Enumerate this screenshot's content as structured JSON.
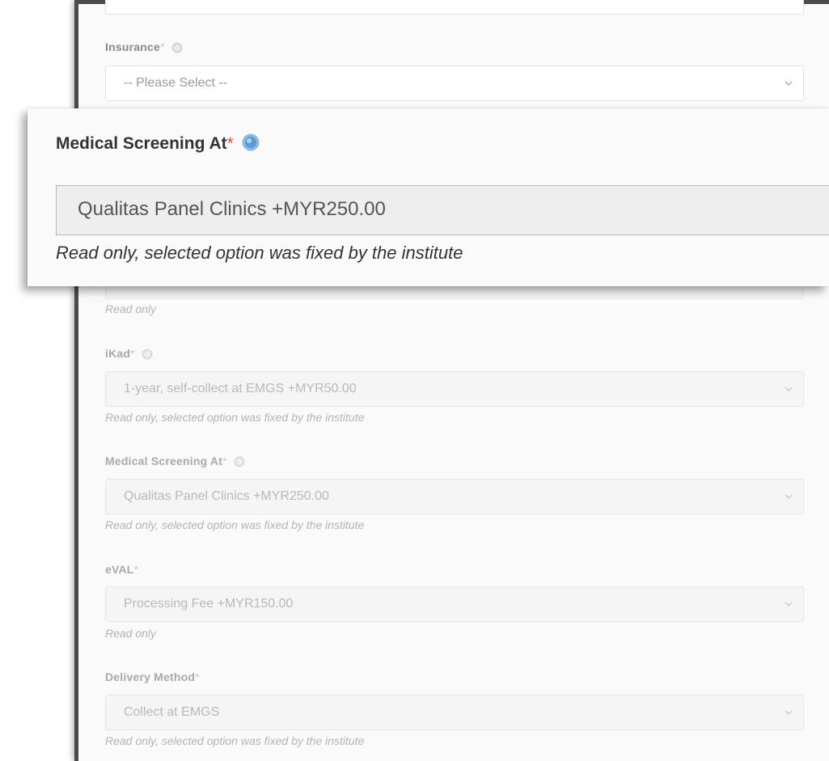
{
  "fields": {
    "top_partial": {
      "value": ""
    },
    "insurance": {
      "label": "Insurance",
      "required_mark": "*",
      "value": "-- Please Select --"
    },
    "hidden_field": {
      "help_text": "Read only"
    },
    "ikad": {
      "label": "iKad",
      "required_mark": "*",
      "value": "1-year, self-collect at EMGS +MYR50.00",
      "help_text": "Read only, selected option was fixed by the institute"
    },
    "medical_screening": {
      "label": "Medical Screening At",
      "required_mark": "*",
      "value": "Qualitas Panel Clinics +MYR250.00",
      "help_text": "Read only, selected option was fixed by the institute"
    },
    "eval": {
      "label": "eVAL",
      "required_mark": "*",
      "value": "Processing Fee +MYR150.00",
      "help_text": "Read only"
    },
    "delivery_method": {
      "label": "Delivery Method",
      "required_mark": "*",
      "value": "Collect at EMGS",
      "help_text": "Read only, selected option was fixed by the institute"
    }
  },
  "zoom_callout": {
    "label": "Medical Screening At",
    "required_mark": "*",
    "value": "Qualitas Panel Clinics +MYR250.00",
    "help_text": "Read only, selected option was fixed by the institute"
  },
  "colors": {
    "required_accent": "#d9534f",
    "help_icon": "#5b9bd5"
  },
  "icons": [
    "help-icon",
    "chevron-down-icon"
  ]
}
